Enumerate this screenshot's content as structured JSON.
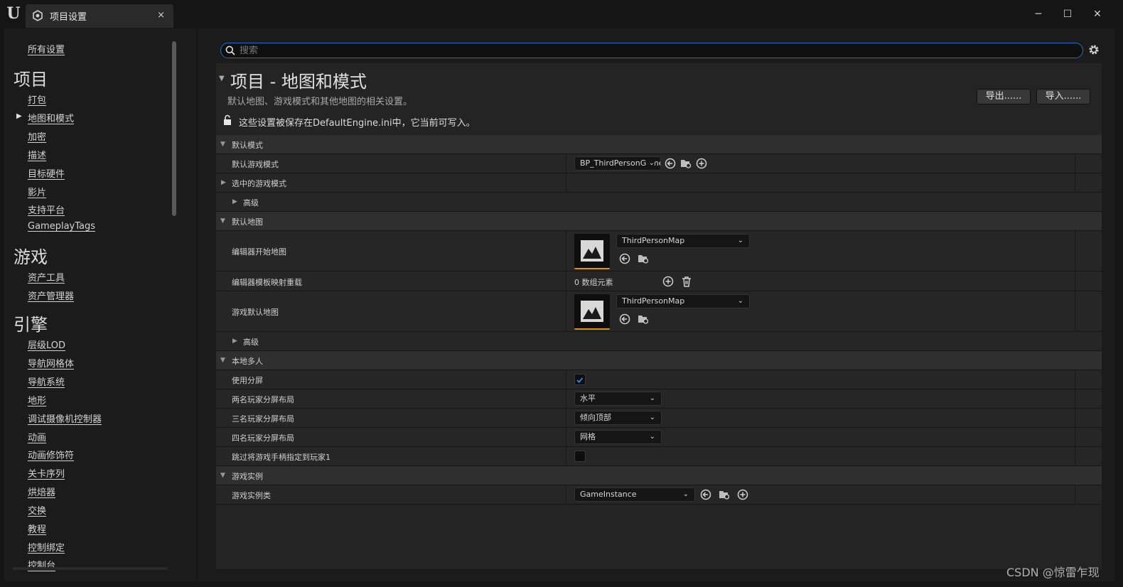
{
  "window": {
    "tab_title": "项目设置",
    "tab_close": "×",
    "minimize": "─",
    "maximize": "☐",
    "close": "✕"
  },
  "sidebar": {
    "all_settings": "所有设置",
    "sections": [
      {
        "title": "项目",
        "items": [
          "打包",
          "地图和模式",
          "加密",
          "描述",
          "目标硬件",
          "影片",
          "支持平台",
          "GameplayTags"
        ]
      },
      {
        "title": "游戏",
        "items": [
          "资产工具",
          "资产管理器"
        ]
      },
      {
        "title": "引擎",
        "items": [
          "层级LOD",
          "导航网格体",
          "导航系统",
          "地形",
          "调试摄像机控制器",
          "动画",
          "动画修饰符",
          "关卡序列",
          "烘焙器",
          "交换",
          "教程",
          "控制绑定",
          "控制台"
        ]
      }
    ],
    "selected": "地图和模式"
  },
  "search": {
    "placeholder": "搜索",
    "value": ""
  },
  "header": {
    "title": "项目 - 地图和模式",
    "description": "默认地图、游戏模式和其他地图的相关设置。",
    "export_label": "导出......",
    "import_label": "导入......",
    "save_note": "这些设置被保存在DefaultEngine.ini中，它当前可写入。"
  },
  "sections": {
    "default_modes": {
      "title": "默认模式",
      "default_game_mode_label": "默认游戏模式",
      "default_game_mode_value": "BP_ThirdPersonGameMode",
      "selected_game_mode_label": "选中的游戏模式",
      "advanced_label": "高级"
    },
    "default_maps": {
      "title": "默认地图",
      "editor_startup_map_label": "编辑器开始地图",
      "editor_startup_map_value": "ThirdPersonMap",
      "editor_template_map_overrides_label": "编辑器模板映射重载",
      "editor_template_map_overrides_value": "0 数组元素",
      "game_default_map_label": "游戏默认地图",
      "game_default_map_value": "ThirdPersonMap",
      "advanced_label": "高级"
    },
    "local_multiplayer": {
      "title": "本地多人",
      "use_splitscreen_label": "使用分屏",
      "use_splitscreen_checked": true,
      "two_player_label": "两名玩家分屏布局",
      "two_player_value": "水平",
      "three_player_label": "三名玩家分屏布局",
      "three_player_value": "倾向顶部",
      "four_player_label": "四名玩家分屏布局",
      "four_player_value": "网格",
      "skip_gamepad_label": "跳过将游戏手柄指定到玩家1",
      "skip_gamepad_checked": false
    },
    "game_instance": {
      "title": "游戏实例",
      "game_instance_class_label": "游戏实例类",
      "game_instance_class_value": "GameInstance"
    }
  },
  "watermark": "CSDN @惊雷乍现",
  "colors": {
    "accent": "#1b6fcc",
    "thumb_underline": "#e08f14",
    "checkbox_check": "#3b8be8"
  }
}
